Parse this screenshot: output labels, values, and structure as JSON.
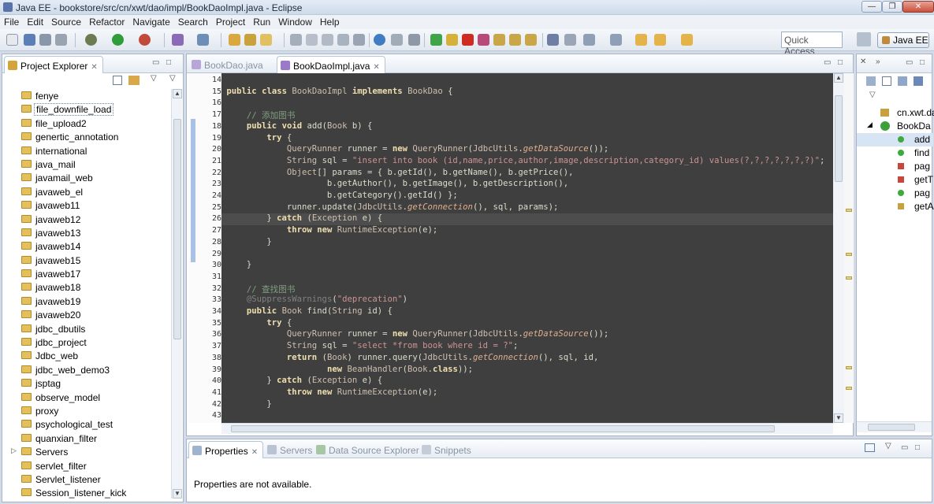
{
  "window": {
    "title": "Java EE - bookstore/src/cn/xwt/dao/impl/BookDaoImpl.java - Eclipse",
    "minimize": "—",
    "maximize": "❐",
    "close": "✕"
  },
  "menu": [
    "File",
    "Edit",
    "Source",
    "Refactor",
    "Navigate",
    "Search",
    "Project",
    "Run",
    "Window",
    "Help"
  ],
  "toolbar": {
    "quick_access": "Quick Access",
    "perspective": "Java EE"
  },
  "explorer": {
    "title": "Project Explorer",
    "items": [
      {
        "label": "fenye"
      },
      {
        "label": "file_downfile_load"
      },
      {
        "label": "file_upload2"
      },
      {
        "label": "genertic_annotation"
      },
      {
        "label": "international"
      },
      {
        "label": "java_mail"
      },
      {
        "label": "javamail_web"
      },
      {
        "label": "javaweb_el"
      },
      {
        "label": "javaweb11"
      },
      {
        "label": "javaweb12"
      },
      {
        "label": "javaweb13"
      },
      {
        "label": "javaweb14"
      },
      {
        "label": "javaweb15"
      },
      {
        "label": "javaweb17"
      },
      {
        "label": "javaweb18"
      },
      {
        "label": "javaweb19"
      },
      {
        "label": "javaweb20"
      },
      {
        "label": "jdbc_dbutils"
      },
      {
        "label": "jdbc_project"
      },
      {
        "label": "Jdbc_web"
      },
      {
        "label": "jdbc_web_demo3"
      },
      {
        "label": "jsptag"
      },
      {
        "label": "observe_model"
      },
      {
        "label": "proxy"
      },
      {
        "label": "psychological_test"
      },
      {
        "label": "quanxian_filter"
      },
      {
        "label": "Servers"
      },
      {
        "label": "servlet_filter"
      },
      {
        "label": "Servlet_listener"
      },
      {
        "label": "Session_listener_kick"
      }
    ]
  },
  "editor": {
    "tabs": [
      {
        "label": "BookDao.java"
      },
      {
        "label": "BookDaoImpl.java"
      }
    ],
    "lines": [
      {
        "n": "14",
        "t": ""
      },
      {
        "n": "15",
        "t": "public class BookDaoImpl implements BookDao {"
      },
      {
        "n": "16",
        "t": ""
      },
      {
        "n": "17",
        "t": "    // 添加图书"
      },
      {
        "n": "18",
        "t": "    public void add(Book b) {"
      },
      {
        "n": "19",
        "t": "        try {"
      },
      {
        "n": "20",
        "t": "            QueryRunner runner = new QueryRunner(JdbcUtils.getDataSource());"
      },
      {
        "n": "21",
        "t": "            String sql = \"insert into book (id,name,price,author,image,description,category_id) values(?,?,?,?,?,?,?)\";"
      },
      {
        "n": "22",
        "t": "            Object[] params = { b.getId(), b.getName(), b.getPrice(),"
      },
      {
        "n": "23",
        "t": "                    b.getAuthor(), b.getImage(), b.getDescription(),"
      },
      {
        "n": "24",
        "t": "                    b.getCategory().getId() };"
      },
      {
        "n": "25",
        "t": "            runner.update(JdbcUtils.getConnection(), sql, params);"
      },
      {
        "n": "26",
        "t": "        } catch (Exception e) {"
      },
      {
        "n": "27",
        "t": "            throw new RuntimeException(e);"
      },
      {
        "n": "28",
        "t": "        }"
      },
      {
        "n": "29",
        "t": ""
      },
      {
        "n": "30",
        "t": "    }"
      },
      {
        "n": "31",
        "t": ""
      },
      {
        "n": "32",
        "t": "    // 查找图书"
      },
      {
        "n": "33",
        "t": "    @SuppressWarnings(\"deprecation\")"
      },
      {
        "n": "34",
        "t": "    public Book find(String id) {"
      },
      {
        "n": "35",
        "t": "        try {"
      },
      {
        "n": "36",
        "t": "            QueryRunner runner = new QueryRunner(JdbcUtils.getDataSource());"
      },
      {
        "n": "37",
        "t": "            String sql = \"select *from book where id = ?\";"
      },
      {
        "n": "38",
        "t": "            return (Book) runner.query(JdbcUtils.getConnection(), sql, id,"
      },
      {
        "n": "39",
        "t": "                    new BeanHandler(Book.class));"
      },
      {
        "n": "40",
        "t": "        } catch (Exception e) {"
      },
      {
        "n": "41",
        "t": "            throw new RuntimeException(e);"
      },
      {
        "n": "42",
        "t": "        }"
      },
      {
        "n": "43",
        "t": ""
      }
    ]
  },
  "outline": {
    "items": [
      {
        "label": "cn.xwt.da"
      },
      {
        "label": "BookDa"
      },
      {
        "label": "add"
      },
      {
        "label": "find"
      },
      {
        "label": "pag"
      },
      {
        "label": "getT"
      },
      {
        "label": "pag"
      },
      {
        "label": "getA"
      }
    ]
  },
  "bottom": {
    "tabs": [
      {
        "label": "Properties"
      },
      {
        "label": "Servers"
      },
      {
        "label": "Data Source Explorer"
      },
      {
        "label": "Snippets"
      }
    ],
    "message": "Properties are not available."
  }
}
